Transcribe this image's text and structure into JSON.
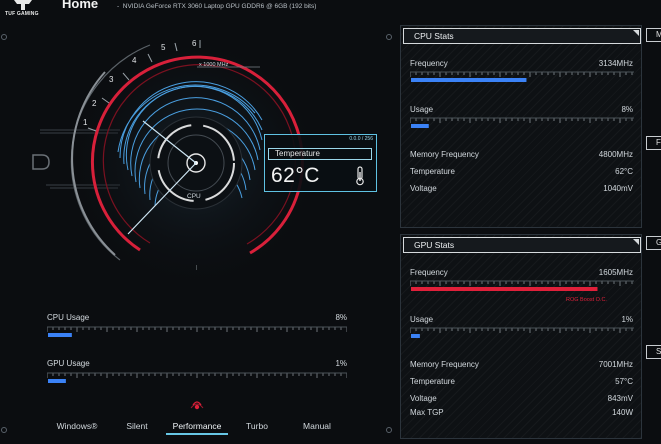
{
  "app": {
    "logo_text": "TUF GAMING",
    "page_title": "Home",
    "gpu_info": "NVIDIA GeForce RTX 3060 Laptop GPU GDDR6 @ 6GB (192 bits)"
  },
  "gauge": {
    "ticks": [
      "1",
      "2",
      "3",
      "4",
      "5",
      "6"
    ],
    "unit": "x 1000 MHz",
    "center_label": "CPU"
  },
  "temperature": {
    "version": "0.0.0 / 256",
    "label": "Temperature",
    "value": "62°C"
  },
  "usage": {
    "cpu": {
      "label": "CPU Usage",
      "value": "8%",
      "fill": 0.08
    },
    "gpu": {
      "label": "GPU Usage",
      "value": "1%",
      "fill": 0.06
    }
  },
  "modes": {
    "items": [
      "Windows®",
      "Silent",
      "Performance",
      "Turbo",
      "Manual"
    ],
    "active": "Performance"
  },
  "cpu_stats": {
    "title": "CPU Stats",
    "frequency": {
      "label": "Frequency",
      "value": "3134MHz",
      "fill": 0.52
    },
    "usage": {
      "label": "Usage",
      "value": "8%",
      "fill": 0.08
    },
    "memory_frequency": {
      "label": "Memory Frequency",
      "value": "4800MHz"
    },
    "temperature": {
      "label": "Temperature",
      "value": "62°C"
    },
    "voltage": {
      "label": "Voltage",
      "value": "1040mV"
    }
  },
  "gpu_stats": {
    "title": "GPU Stats",
    "frequency": {
      "label": "Frequency",
      "value": "1605MHz",
      "fill": 0.84
    },
    "boost_label": "ROG Boost O.C.",
    "usage": {
      "label": "Usage",
      "value": "1%",
      "fill": 0.04
    },
    "memory_frequency": {
      "label": "Memory Frequency",
      "value": "7001MHz"
    },
    "temperature": {
      "label": "Temperature",
      "value": "57°C"
    },
    "voltage": {
      "label": "Voltage",
      "value": "843mV"
    },
    "max_tgp": {
      "label": "Max TGP",
      "value": "140W"
    }
  },
  "side_tabs": [
    "M",
    "F",
    "G",
    "S"
  ],
  "colors": {
    "accent_blue": "#4a9fe0",
    "accent_red": "#e0203a",
    "panel_border": "#2c343c"
  }
}
